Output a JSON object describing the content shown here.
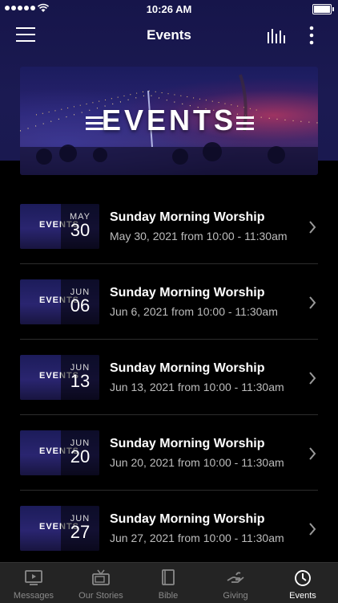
{
  "status": {
    "time": "10:26 AM"
  },
  "nav": {
    "title": "Events"
  },
  "banner": {
    "text": "EVENTS"
  },
  "events": [
    {
      "title": "Sunday Morning Worship",
      "month": "MAY",
      "day": "30",
      "details": "May 30, 2021 from 10:00 - 11:30am",
      "thumb_text": "EVENTS"
    },
    {
      "title": "Sunday Morning Worship",
      "month": "JUN",
      "day": "06",
      "details": "Jun 6, 2021 from 10:00 - 11:30am",
      "thumb_text": "EVENTS"
    },
    {
      "title": "Sunday Morning Worship",
      "month": "JUN",
      "day": "13",
      "details": "Jun 13, 2021 from 10:00 - 11:30am",
      "thumb_text": "EVENTS"
    },
    {
      "title": "Sunday Morning Worship",
      "month": "JUN",
      "day": "20",
      "details": "Jun 20, 2021 from 10:00 - 11:30am",
      "thumb_text": "EVENTS"
    },
    {
      "title": "Sunday Morning Worship",
      "month": "JUN",
      "day": "27",
      "details": "Jun 27, 2021 from 10:00 - 11:30am",
      "thumb_text": "EVENTS"
    }
  ],
  "tabs": [
    {
      "label": "Messages",
      "icon": "play-screen-icon",
      "active": false
    },
    {
      "label": "Our Stories",
      "icon": "tv-icon",
      "active": false
    },
    {
      "label": "Bible",
      "icon": "book-icon",
      "active": false
    },
    {
      "label": "Giving",
      "icon": "giving-hand-icon",
      "active": false
    },
    {
      "label": "Events",
      "icon": "clock-icon",
      "active": true
    }
  ],
  "colors": {
    "background": "#000000",
    "header": "#1b1a52",
    "tabbar": "#242424",
    "muted_text": "#bdbdbd"
  }
}
